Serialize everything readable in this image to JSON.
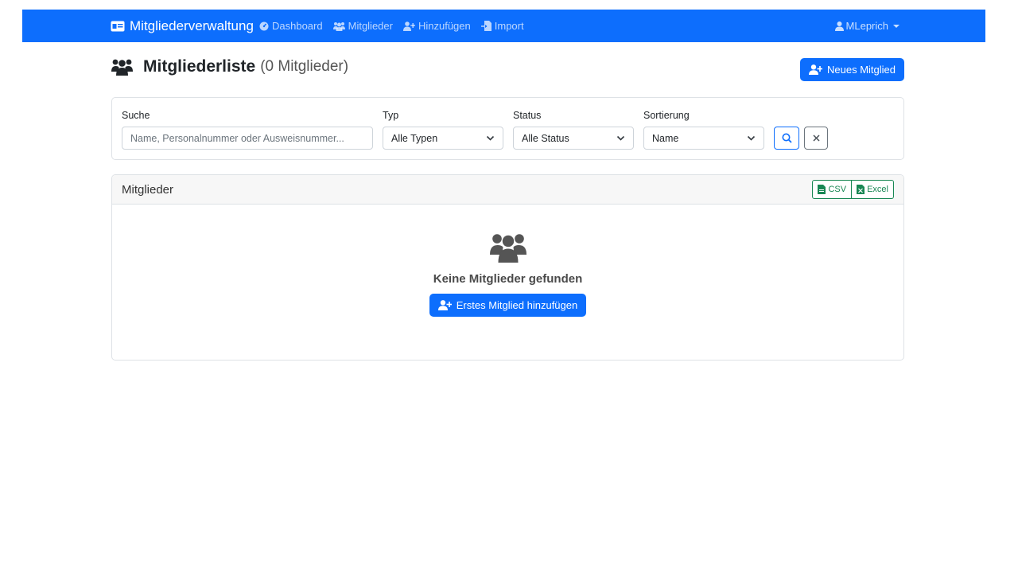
{
  "navbar": {
    "brand": "Mitgliederverwaltung",
    "links": [
      {
        "label": "Dashboard",
        "icon": "tachometer-icon"
      },
      {
        "label": "Mitglieder",
        "icon": "users-icon"
      },
      {
        "label": "Hinzufügen",
        "icon": "user-plus-icon"
      },
      {
        "label": "Import",
        "icon": "file-import-icon"
      }
    ],
    "user": "MLeprich"
  },
  "header": {
    "title": "Mitgliederliste",
    "count": "(0 Mitglieder)",
    "new_button": "Neues Mitglied"
  },
  "filters": {
    "search_label": "Suche",
    "search_placeholder": "Name, Personalnummer oder Ausweisnummer...",
    "type_label": "Typ",
    "type_value": "Alle Typen",
    "status_label": "Status",
    "status_value": "Alle Status",
    "sort_label": "Sortierung",
    "sort_value": "Name"
  },
  "list": {
    "title": "Mitglieder",
    "export_csv": "CSV",
    "export_excel": "Excel",
    "empty_message": "Keine Mitglieder gefunden",
    "empty_button": "Erstes Mitglied hinzufügen"
  },
  "colors": {
    "primary": "#0d6efd",
    "success": "#198754",
    "muted_icon": "#555555"
  }
}
